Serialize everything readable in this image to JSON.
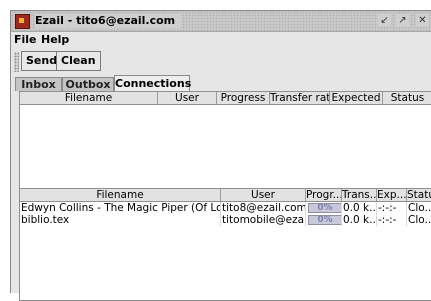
{
  "window": {
    "title": "Ezail - tito6@ezail.com"
  },
  "menu": {
    "file": "File",
    "help": "Help"
  },
  "toolbar": {
    "send": "Send",
    "clean": "Clean"
  },
  "tabs": [
    {
      "label": "Inbox",
      "active": false
    },
    {
      "label": "Outbox",
      "active": false
    },
    {
      "label": "Connections",
      "active": true
    }
  ],
  "top_table": {
    "columns": [
      "Filename",
      "User",
      "Progress",
      "Transfer rate",
      "Expected",
      "Status"
    ],
    "rows": []
  },
  "bottom_table": {
    "columns": [
      "Filename",
      "User",
      "Progr...",
      "Trans...",
      "Exp...",
      "Status"
    ],
    "rows": [
      {
        "filename": "Edwyn Collins - The Magic Piper (Of Love)....",
        "user": "tito8@ezail.com",
        "progress": "0%",
        "rate": "0.0 k...",
        "expected": "-:-:-",
        "status": "Clo..."
      },
      {
        "filename": "biblio.tex",
        "user": "titomobile@ezail...",
        "progress": "0%",
        "rate": "0.0 k...",
        "expected": "-:-:-",
        "status": "Clo..."
      }
    ]
  },
  "colors": {
    "app_icon": "#a0281c",
    "progress_text": "#7b82b0",
    "window_bg": "#e6e6e6"
  }
}
